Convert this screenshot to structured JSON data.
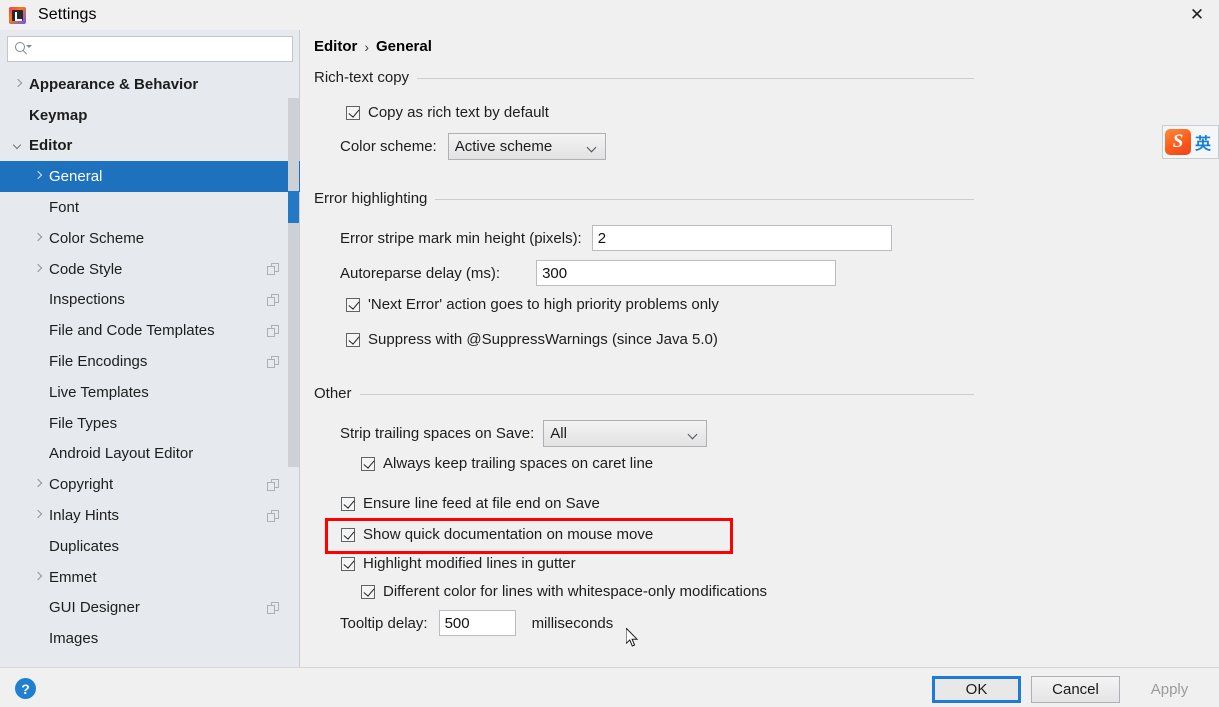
{
  "window": {
    "title": "Settings",
    "app_icon": "intellij-idea-icon",
    "close_label": "✕"
  },
  "sidebar": {
    "search": {
      "value": "",
      "placeholder": ""
    },
    "items": [
      {
        "label": "Appearance & Behavior",
        "depth": 0,
        "arrow": "right",
        "bold": true,
        "selected": false,
        "copy": false
      },
      {
        "label": "Keymap",
        "depth": 0,
        "arrow": "none",
        "bold": true,
        "selected": false,
        "copy": false
      },
      {
        "label": "Editor",
        "depth": 0,
        "arrow": "down",
        "bold": true,
        "selected": false,
        "copy": false
      },
      {
        "label": "General",
        "depth": 1,
        "arrow": "right",
        "bold": false,
        "selected": true,
        "copy": false
      },
      {
        "label": "Font",
        "depth": 1,
        "arrow": "none",
        "bold": false,
        "selected": false,
        "copy": false
      },
      {
        "label": "Color Scheme",
        "depth": 1,
        "arrow": "right",
        "bold": false,
        "selected": false,
        "copy": false
      },
      {
        "label": "Code Style",
        "depth": 1,
        "arrow": "right",
        "bold": false,
        "selected": false,
        "copy": true
      },
      {
        "label": "Inspections",
        "depth": 1,
        "arrow": "none",
        "bold": false,
        "selected": false,
        "copy": true
      },
      {
        "label": "File and Code Templates",
        "depth": 1,
        "arrow": "none",
        "bold": false,
        "selected": false,
        "copy": true
      },
      {
        "label": "File Encodings",
        "depth": 1,
        "arrow": "none",
        "bold": false,
        "selected": false,
        "copy": true
      },
      {
        "label": "Live Templates",
        "depth": 1,
        "arrow": "none",
        "bold": false,
        "selected": false,
        "copy": false
      },
      {
        "label": "File Types",
        "depth": 1,
        "arrow": "none",
        "bold": false,
        "selected": false,
        "copy": false
      },
      {
        "label": "Android Layout Editor",
        "depth": 1,
        "arrow": "none",
        "bold": false,
        "selected": false,
        "copy": false
      },
      {
        "label": "Copyright",
        "depth": 1,
        "arrow": "right",
        "bold": false,
        "selected": false,
        "copy": true
      },
      {
        "label": "Inlay Hints",
        "depth": 1,
        "arrow": "right",
        "bold": false,
        "selected": false,
        "copy": true
      },
      {
        "label": "Duplicates",
        "depth": 1,
        "arrow": "none",
        "bold": false,
        "selected": false,
        "copy": false
      },
      {
        "label": "Emmet",
        "depth": 1,
        "arrow": "right",
        "bold": false,
        "selected": false,
        "copy": false
      },
      {
        "label": "GUI Designer",
        "depth": 1,
        "arrow": "none",
        "bold": false,
        "selected": false,
        "copy": true
      },
      {
        "label": "Images",
        "depth": 1,
        "arrow": "none",
        "bold": false,
        "selected": false,
        "copy": false
      }
    ]
  },
  "content": {
    "breadcrumb": {
      "root": "Editor",
      "separator": "›",
      "leaf": "General"
    },
    "sections": {
      "rich_text_copy": {
        "title": "Rich-text copy",
        "copy_as_rich_text": {
          "label": "Copy as rich text by default",
          "checked": true
        },
        "color_scheme": {
          "label": "Color scheme:",
          "value": "Active scheme"
        }
      },
      "error_highlighting": {
        "title": "Error highlighting",
        "stripe_min_height": {
          "label": "Error stripe mark min height (pixels):",
          "value": "2"
        },
        "autoreparse_delay": {
          "label": "Autoreparse delay (ms):",
          "value": "300"
        },
        "next_error": {
          "label": "'Next Error' action goes to high priority problems only",
          "checked": true
        },
        "suppress_warnings": {
          "label": "Suppress with @SuppressWarnings (since Java 5.0)",
          "checked": true
        }
      },
      "other": {
        "title": "Other",
        "strip_trailing": {
          "label": "Strip trailing spaces on Save:",
          "value": "All"
        },
        "keep_trailing_caret": {
          "label": "Always keep trailing spaces on caret line",
          "checked": true
        },
        "ensure_line_feed": {
          "label": "Ensure line feed at file end on Save",
          "checked": true
        },
        "show_quick_doc": {
          "label": "Show quick documentation on mouse move",
          "checked": true,
          "highlighted": true
        },
        "highlight_modified": {
          "label": "Highlight modified lines in gutter",
          "checked": true
        },
        "different_color_ws": {
          "label": "Different color for lines with whitespace-only modifications",
          "checked": true
        },
        "tooltip_delay": {
          "label": "Tooltip delay:",
          "value": "500",
          "unit": "milliseconds"
        }
      }
    }
  },
  "footer": {
    "help_label": "?",
    "ok_label": "OK",
    "cancel_label": "Cancel",
    "apply_label": "Apply"
  },
  "ime": {
    "logo_letter": "S",
    "mode_label": "英"
  },
  "colors": {
    "selection_blue": "#1e72bd",
    "highlight_red": "#ff0000",
    "focus_blue": "#1e7bd6",
    "sidebar_bg": "#e6eaee",
    "content_bg": "#f0f0f0"
  }
}
